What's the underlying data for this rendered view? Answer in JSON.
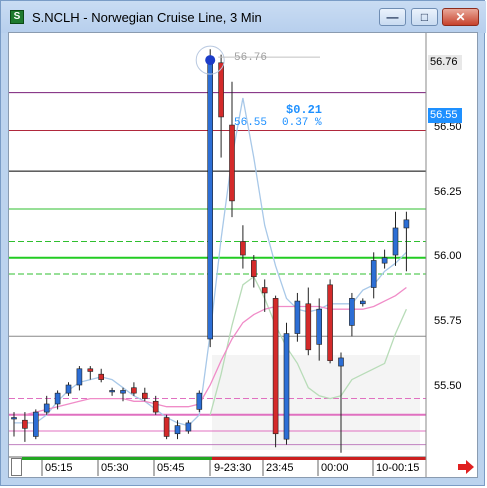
{
  "window": {
    "title": "S.NCLH - Norwegian Cruise Line, 3 Min",
    "icon_label": "S",
    "buttons": {
      "minimize": "minimize-icon",
      "maximize": "maximize-icon",
      "close": "close-icon"
    }
  },
  "price_axis": {
    "labels": [
      "56.50",
      "56.25",
      "56.00",
      "55.75",
      "55.50"
    ],
    "last_price_tag": "56.76",
    "current_price_tag": "56.55"
  },
  "time_axis": {
    "labels": [
      "05:15",
      "05:30",
      "05:45",
      "9-23:30",
      "23:45",
      "00:00",
      "10-00:15"
    ]
  },
  "annotations": {
    "high_label": "56.76",
    "change_amount": "$0.21",
    "change_price": "56.55",
    "change_pct": "0.37 %"
  },
  "colors": {
    "up_candle": "#2c6ed5",
    "down_candle": "#d42a2a",
    "bg": "#ffffff",
    "accent_blue": "#1e90ff",
    "scroll_arrow": "#e02020",
    "session_bar_green": "#22a722",
    "session_bar_red": "#cc2020"
  },
  "chart_data": {
    "type": "candlestick",
    "title": "S.NCLH - Norwegian Cruise Line, 3 Min",
    "ylim": [
      55.32,
      56.86
    ],
    "candles": [
      {
        "o": 55.44,
        "h": 55.46,
        "l": 55.37,
        "c": 55.44
      },
      {
        "o": 55.43,
        "h": 55.46,
        "l": 55.35,
        "c": 55.4
      },
      {
        "o": 55.37,
        "h": 55.47,
        "l": 55.36,
        "c": 55.46
      },
      {
        "o": 55.46,
        "h": 55.52,
        "l": 55.45,
        "c": 55.49
      },
      {
        "o": 55.49,
        "h": 55.54,
        "l": 55.47,
        "c": 55.53
      },
      {
        "o": 55.53,
        "h": 55.57,
        "l": 55.52,
        "c": 55.56
      },
      {
        "o": 55.56,
        "h": 55.63,
        "l": 55.54,
        "c": 55.62
      },
      {
        "o": 55.62,
        "h": 55.63,
        "l": 55.58,
        "c": 55.61
      },
      {
        "o": 55.6,
        "h": 55.62,
        "l": 55.57,
        "c": 55.58
      },
      {
        "o": 55.54,
        "h": 55.55,
        "l": 55.52,
        "c": 55.54
      },
      {
        "o": 55.53,
        "h": 55.55,
        "l": 55.5,
        "c": 55.54
      },
      {
        "o": 55.55,
        "h": 55.57,
        "l": 55.52,
        "c": 55.53
      },
      {
        "o": 55.53,
        "h": 55.55,
        "l": 55.5,
        "c": 55.51
      },
      {
        "o": 55.5,
        "h": 55.52,
        "l": 55.45,
        "c": 55.46
      },
      {
        "o": 55.44,
        "h": 55.45,
        "l": 55.36,
        "c": 55.37
      },
      {
        "o": 55.38,
        "h": 55.43,
        "l": 55.36,
        "c": 55.41
      },
      {
        "o": 55.39,
        "h": 55.43,
        "l": 55.38,
        "c": 55.42
      },
      {
        "o": 55.47,
        "h": 55.54,
        "l": 55.46,
        "c": 55.53
      },
      {
        "o": 55.73,
        "h": 56.8,
        "l": 55.7,
        "c": 56.76
      },
      {
        "o": 56.75,
        "h": 56.78,
        "l": 56.4,
        "c": 56.55
      },
      {
        "o": 56.52,
        "h": 56.68,
        "l": 56.18,
        "c": 56.24
      },
      {
        "o": 56.09,
        "h": 56.15,
        "l": 55.99,
        "c": 56.04
      },
      {
        "o": 56.02,
        "h": 56.04,
        "l": 55.92,
        "c": 55.96
      },
      {
        "o": 55.92,
        "h": 55.95,
        "l": 55.83,
        "c": 55.9
      },
      {
        "o": 55.88,
        "h": 55.89,
        "l": 55.33,
        "c": 55.38
      },
      {
        "o": 55.36,
        "h": 55.79,
        "l": 55.34,
        "c": 55.75
      },
      {
        "o": 55.75,
        "h": 55.9,
        "l": 55.72,
        "c": 55.87
      },
      {
        "o": 55.86,
        "h": 55.92,
        "l": 55.67,
        "c": 55.69
      },
      {
        "o": 55.71,
        "h": 55.88,
        "l": 55.65,
        "c": 55.84
      },
      {
        "o": 55.93,
        "h": 55.95,
        "l": 55.64,
        "c": 55.65
      },
      {
        "o": 55.63,
        "h": 55.68,
        "l": 55.31,
        "c": 55.66
      },
      {
        "o": 55.78,
        "h": 55.9,
        "l": 55.74,
        "c": 55.88
      },
      {
        "o": 55.86,
        "h": 55.88,
        "l": 55.85,
        "c": 55.87
      },
      {
        "o": 55.92,
        "h": 56.05,
        "l": 55.88,
        "c": 56.02
      },
      {
        "o": 56.01,
        "h": 56.06,
        "l": 55.99,
        "c": 56.03
      },
      {
        "o": 56.04,
        "h": 56.2,
        "l": 56.0,
        "c": 56.14
      },
      {
        "o": 56.14,
        "h": 56.2,
        "l": 55.98,
        "c": 56.17
      }
    ],
    "series": [
      {
        "name": "light-blue",
        "values": [
          55.42,
          55.42,
          55.42,
          55.45,
          55.5,
          55.54,
          55.57,
          55.58,
          55.59,
          55.58,
          55.55,
          55.52,
          55.5,
          55.47,
          55.44,
          55.42,
          55.41,
          55.45,
          55.75,
          56.1,
          56.4,
          56.62,
          56.4,
          56.15,
          56.0,
          55.88,
          55.84,
          55.83,
          55.84,
          55.86,
          55.86,
          55.86,
          55.91,
          55.93,
          55.98,
          56.01,
          56.05
        ]
      },
      {
        "name": "light-green",
        "values": [
          null,
          null,
          null,
          null,
          null,
          null,
          null,
          null,
          null,
          null,
          null,
          null,
          null,
          null,
          null,
          null,
          null,
          null,
          55.45,
          55.6,
          55.78,
          55.93,
          55.96,
          55.88,
          55.78,
          55.7,
          55.64,
          55.55,
          55.52,
          55.51,
          55.52,
          55.58,
          55.6,
          55.62,
          55.64,
          55.75,
          55.84
        ]
      },
      {
        "name": "pink",
        "values": [
          55.45,
          55.45,
          55.46,
          55.47,
          55.48,
          55.49,
          55.5,
          55.51,
          55.51,
          55.51,
          55.51,
          55.5,
          55.5,
          55.49,
          55.48,
          55.48,
          55.48,
          55.49,
          55.56,
          55.65,
          55.73,
          55.79,
          55.82,
          55.84,
          55.85,
          55.85,
          55.85,
          55.85,
          55.85,
          55.84,
          55.84,
          55.84,
          55.84,
          55.85,
          55.87,
          55.89,
          55.92
        ]
      }
    ],
    "hlines": [
      {
        "y": 56.64,
        "color": "#7a1f7a"
      },
      {
        "y": 56.5,
        "color": "#b0283c"
      },
      {
        "y": 56.35,
        "color": "#000000"
      },
      {
        "y": 56.21,
        "color": "#2fbf2f"
      },
      {
        "y": 56.09,
        "color": "#2fbf2f",
        "dash": true
      },
      {
        "y": 56.03,
        "color": "#22cc22",
        "width": 2
      },
      {
        "y": 55.97,
        "color": "#2fbf2f",
        "dash": true
      },
      {
        "y": 55.74,
        "color": "#888888"
      },
      {
        "y": 55.51,
        "color": "#e070c0",
        "dash": true
      },
      {
        "y": 55.45,
        "color": "#e070c0",
        "width": 2
      },
      {
        "y": 55.39,
        "color": "#e070c0"
      },
      {
        "y": 55.34,
        "color": "#c080c0"
      }
    ],
    "grid": false
  }
}
